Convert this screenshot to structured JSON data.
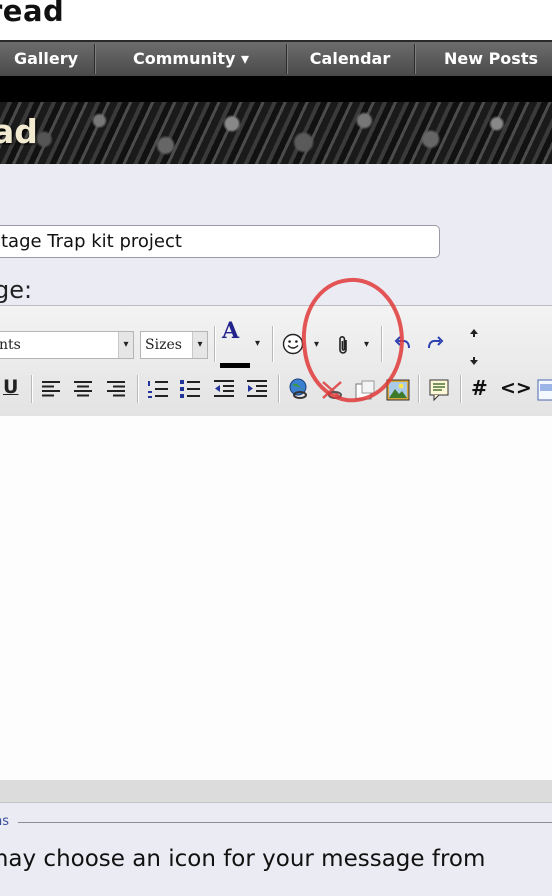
{
  "header": {
    "title_fragment": "read"
  },
  "nav": {
    "items": [
      "Gallery",
      "Community ▾",
      "Calendar",
      "New Posts"
    ]
  },
  "banner": {
    "text_fragment": "ad"
  },
  "form": {
    "title_value": "tage Trap kit project",
    "message_label": "ge:"
  },
  "toolbar": {
    "font_select": "nts",
    "size_select": "Sizes",
    "dropdown_arrow": "▾",
    "color_letter": "A",
    "bold_underline": "U",
    "hash_label": "#",
    "code_label": "<>"
  },
  "legend": {
    "text": "ns"
  },
  "icon_note": "may choose an icon for your message from",
  "icons": [
    "underline-icon",
    "align-left-icon",
    "align-center-icon",
    "align-right-icon",
    "ordered-list-icon",
    "unordered-list-icon",
    "outdent-icon",
    "indent-icon",
    "link-icon",
    "unlink-icon",
    "email-icon",
    "image-icon",
    "quote-icon",
    "hash-icon",
    "code-icon",
    "php-icon",
    "smiley-icon",
    "attachment-icon",
    "undo-icon",
    "redo-icon",
    "resize-up-icon",
    "resize-down-icon"
  ],
  "colors": {
    "navbar": "#5a5a5a",
    "annotation": "#e03a3a",
    "form_bg": "#ebebf3"
  }
}
